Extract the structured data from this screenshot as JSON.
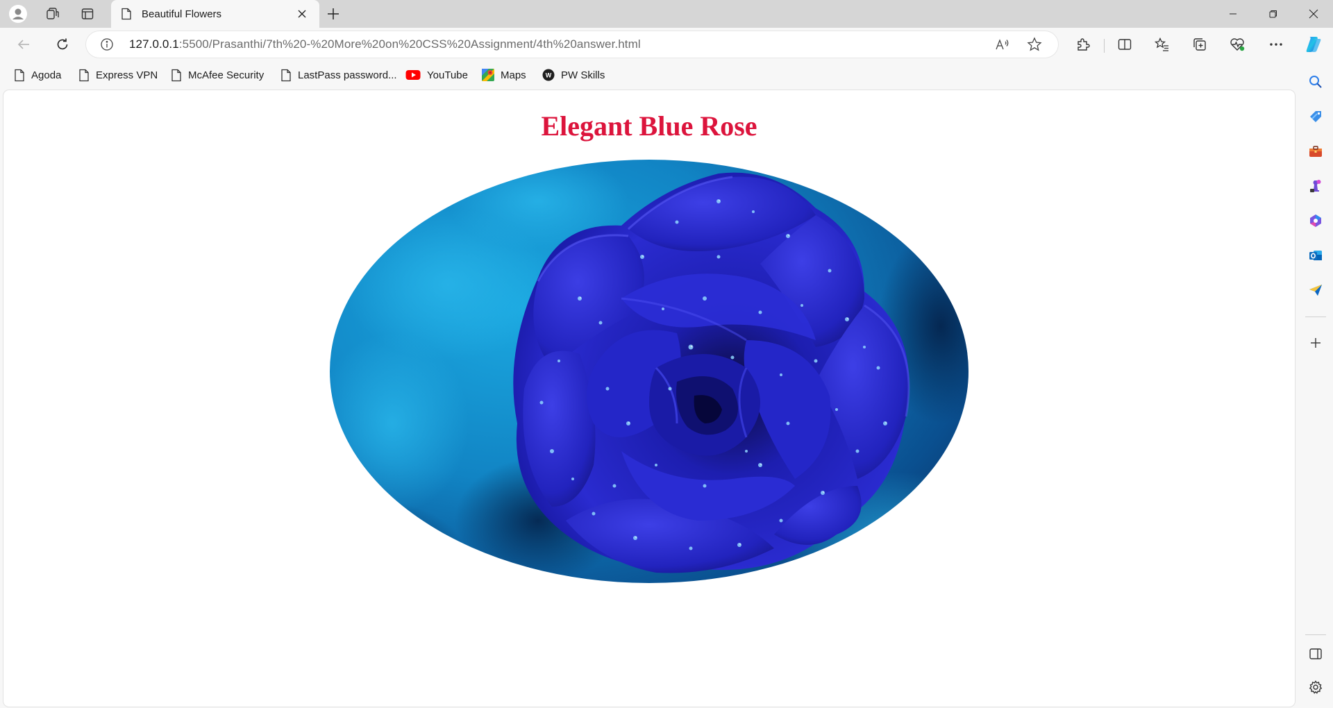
{
  "browser": {
    "tab": {
      "title": "Beautiful Flowers"
    },
    "address": {
      "host": "127.0.0.1",
      "path": ":5500/Prasanthi/7th%20-%20More%20on%20CSS%20Assignment/4th%20answer.html"
    },
    "favorites": [
      {
        "label": "Agoda",
        "icon": "page-icon"
      },
      {
        "label": "Express VPN",
        "icon": "page-icon"
      },
      {
        "label": "McAfee Security",
        "icon": "page-icon"
      },
      {
        "label": "LastPass password...",
        "icon": "page-icon"
      },
      {
        "label": "YouTube",
        "icon": "youtube-icon"
      },
      {
        "label": "Maps",
        "icon": "maps-icon"
      },
      {
        "label": "PW Skills",
        "icon": "pw-skills-icon"
      }
    ],
    "colors": {
      "accent": "#0f6cbd",
      "youtube": "#ff0000"
    }
  },
  "page": {
    "title": "Elegant Blue Rose",
    "title_color": "#dc143c",
    "image": {
      "subject": "blue rose with water droplets",
      "shape": "ellipse"
    }
  }
}
